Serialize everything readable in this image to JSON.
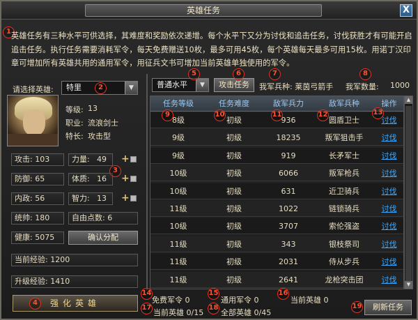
{
  "window": {
    "title": "英雄任务",
    "close_label": "X"
  },
  "markers": [
    "1",
    "2",
    "3",
    "4",
    "5",
    "6",
    "7",
    "8",
    "9",
    "10",
    "11",
    "12",
    "13",
    "14",
    "15",
    "16",
    "17",
    "18",
    "19"
  ],
  "description": "英雄任务有三种水平可供选择，其难度和奖励依次递增。每个水平下又分为讨伐和追击任务，讨伐获胜才有可能开启追击任务。执行任务需要消耗军令，每天免费赠送10枚，最多可用45枚，每个英雄每天最多可用15枚。用诺丁汉印章可增加所有英雄共用的通用军令，用征兵文书可增加当前英雄单独使用的军令。",
  "hero": {
    "select_label": "请选择英雄:",
    "selected": "特里",
    "level_label": "等级:",
    "level": "13",
    "job_label": "职业:",
    "job": "流浪剑士",
    "trait_label": "特长:",
    "trait": "攻击型"
  },
  "stats": {
    "attack": "攻击: 103",
    "defense": "防御: 65",
    "politics": "内政: 56",
    "command": "统帅: 180",
    "health": "健康: 5075",
    "strength_label": "力量:",
    "strength": "49",
    "constitution_label": "体质:",
    "constitution": "16",
    "intellect_label": "智力:",
    "intellect": "13",
    "free_points": "自由点数: 6",
    "confirm_label": "确认分配",
    "current_exp": "当前经验: 1200",
    "level_exp": "升级经验: 1410",
    "strengthen_label": "强化英雄"
  },
  "controls": {
    "difficulty": "普通水平",
    "attack_task": "攻击任务",
    "troop_type": "我军兵种: 莱茵弓箭手",
    "troop_count_label": "我军数量:",
    "troop_count": "1000"
  },
  "table": {
    "headers": [
      "任务等级",
      "任务难度",
      "敌军兵力",
      "敌军兵种",
      "操作"
    ],
    "rows": [
      [
        "8级",
        "初级",
        "936",
        "圆盾卫士",
        "讨伐"
      ],
      [
        "9级",
        "初级",
        "18235",
        "叛军狙击手",
        "讨伐"
      ],
      [
        "9级",
        "初级",
        "919",
        "长矛军士",
        "讨伐"
      ],
      [
        "10级",
        "初级",
        "6066",
        "叛军枪兵",
        "讨伐"
      ],
      [
        "10级",
        "初级",
        "631",
        "近卫骑兵",
        "讨伐"
      ],
      [
        "11级",
        "初级",
        "1022",
        "链锁骑兵",
        "讨伐"
      ],
      [
        "10级",
        "初级",
        "3707",
        "索伦强盗",
        "讨伐"
      ],
      [
        "11级",
        "初级",
        "343",
        "银枝祭司",
        "讨伐"
      ],
      [
        "11级",
        "初级",
        "2031",
        "侍从步兵",
        "讨伐"
      ],
      [
        "11级",
        "初级",
        "2641",
        "龙枪突击团",
        "讨伐"
      ]
    ]
  },
  "footer": {
    "free_orders": "免费军令 0",
    "general_orders": "通用军令 0",
    "current_hero": "当前英雄 0",
    "current_hero_count": "当前英雄 0/15",
    "all_heroes": "全部英雄 0/45",
    "refresh_label": "刷新任务"
  }
}
